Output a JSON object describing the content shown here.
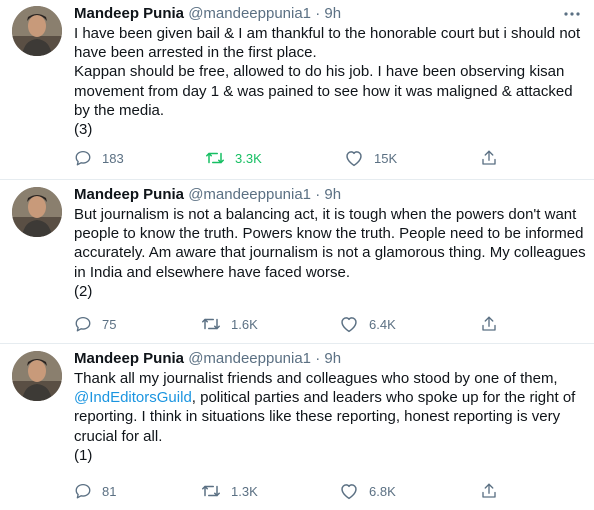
{
  "tweets": [
    {
      "name": "Mandeep Punia",
      "handle": "@mandeeppunia1",
      "separator": "·",
      "time": "9h",
      "lines": [
        "I have been given bail & I am thankful to the honorable court but i should not have been arrested in the first place.",
        "Kappan should be free, allowed to do his job. I have been observing kisan movement from day 1 & was pained to see how it was maligned & attacked by the media.",
        "(3)"
      ],
      "replies": "183",
      "retweets": "3.3K",
      "retweeted": true,
      "likes": "15K"
    },
    {
      "name": "Mandeep Punia",
      "handle": "@mandeeppunia1",
      "separator": "·",
      "time": "9h",
      "lines": [
        "But journalism is not a balancing act, it is tough when the powers don't want people to know the truth. Powers know the truth. People need to be informed accurately. Am aware that journalism is not a glamorous thing. My colleagues in India and elsewhere have faced worse.",
        "(2)"
      ],
      "replies": "75",
      "retweets": "1.6K",
      "retweeted": false,
      "likes": "6.4K"
    },
    {
      "name": "Mandeep Punia",
      "handle": "@mandeeppunia1",
      "separator": "·",
      "time": "9h",
      "line_pre": "Thank all my journalist friends and colleagues who stood by one of them, ",
      "mention": "@IndEditorsGuild",
      "line_post": ", political parties and leaders who spoke up for the right of reporting. I think in situations like these reporting, honest reporting is very crucial for all.",
      "last_line": "(1)",
      "replies": "81",
      "retweets": "1.3K",
      "retweeted": false,
      "likes": "6.8K"
    }
  ],
  "icons": {
    "reply": "reply-icon",
    "retweet": "retweet-icon",
    "like": "heart-icon",
    "share": "share-icon",
    "more": "more-icon"
  },
  "colors": {
    "text": "#0f1419",
    "muted": "#5b7083",
    "retweet_active": "#17bf63",
    "link": "#1b95e0",
    "divider": "#e6ecf0"
  }
}
